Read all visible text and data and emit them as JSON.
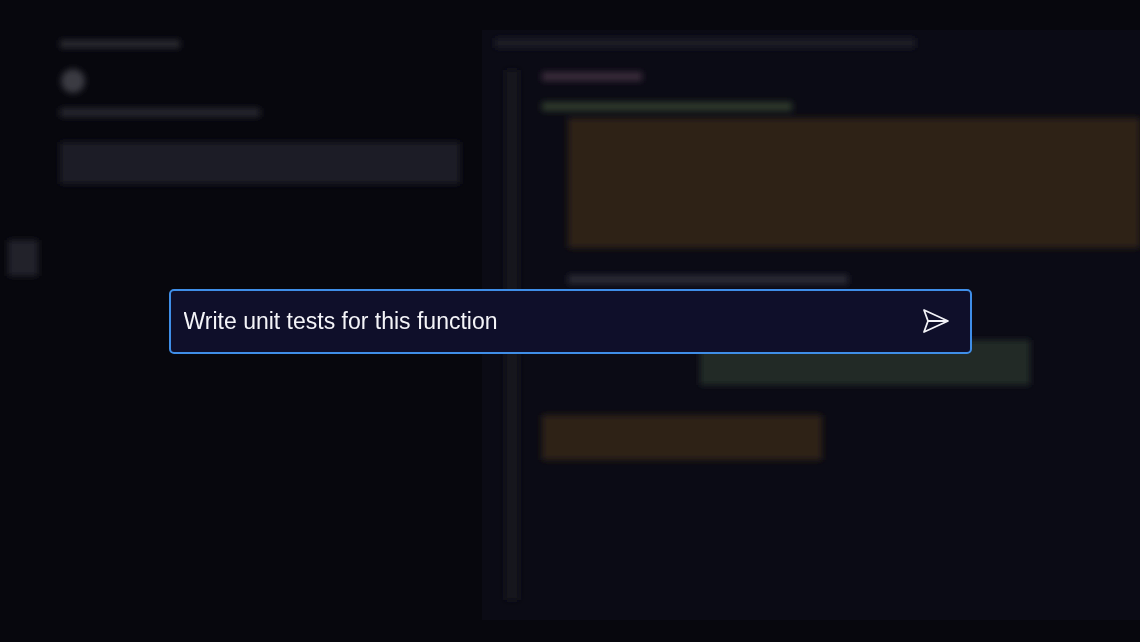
{
  "prompt": {
    "value": "Write unit tests for this function",
    "focused": true
  }
}
